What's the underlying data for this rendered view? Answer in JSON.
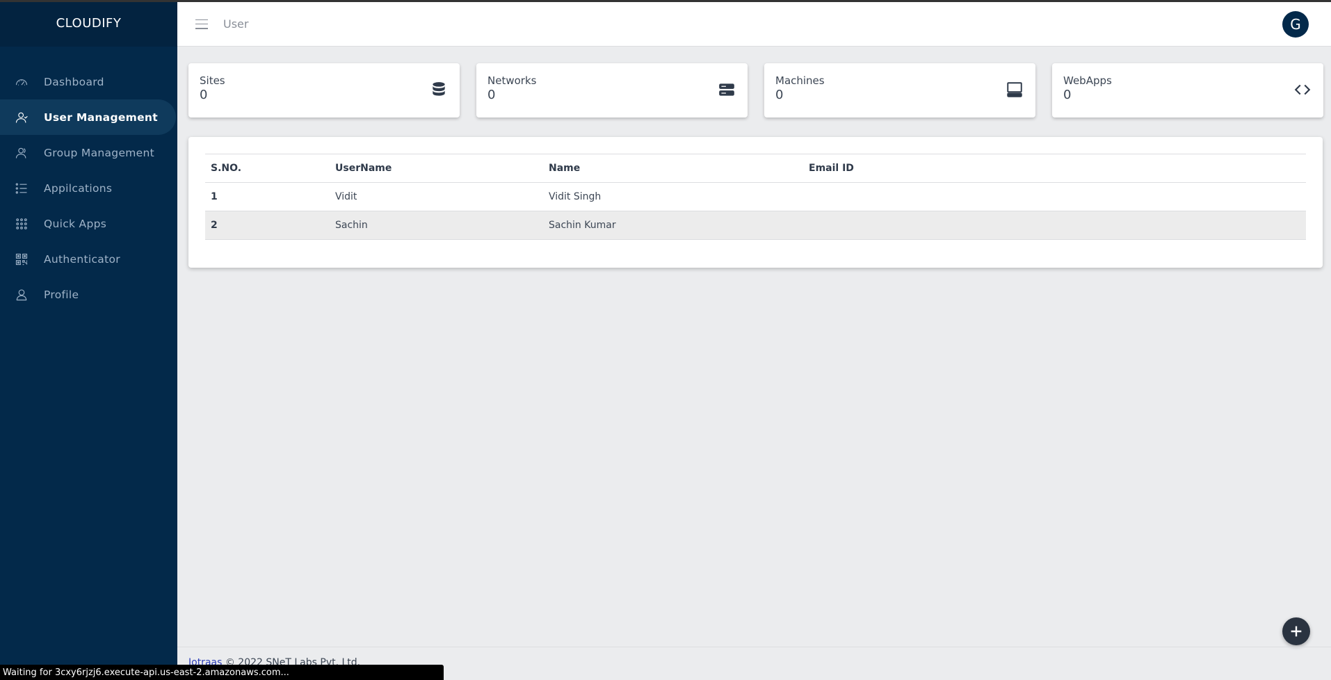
{
  "brand": "CLOUDIFY",
  "sidebar": {
    "items": [
      {
        "label": "Dashboard",
        "icon": "gauge-icon"
      },
      {
        "label": "User Management",
        "icon": "users-icon",
        "active": true
      },
      {
        "label": "Group Management",
        "icon": "group-icon"
      },
      {
        "label": "Appilcations",
        "icon": "list-icon"
      },
      {
        "label": "Quick Apps",
        "icon": "grid-icon"
      },
      {
        "label": "Authenticator",
        "icon": "qr-icon"
      },
      {
        "label": "Profile",
        "icon": "person-icon"
      }
    ]
  },
  "header": {
    "title": "User",
    "avatar_letter": "G"
  },
  "cards": [
    {
      "label": "Sites",
      "value": "0",
      "icon": "database-icon"
    },
    {
      "label": "Networks",
      "value": "0",
      "icon": "server-icon"
    },
    {
      "label": "Machines",
      "value": "0",
      "icon": "computer-icon"
    },
    {
      "label": "WebApps",
      "value": "0",
      "icon": "code-icon"
    }
  ],
  "table": {
    "headers": [
      "S.NO.",
      "UserName",
      "Name",
      "Email ID"
    ],
    "rows": [
      {
        "sno": "1",
        "username": "Vidit",
        "name": "Vidit Singh",
        "email": ""
      },
      {
        "sno": "2",
        "username": "Sachin",
        "name": "Sachin Kumar",
        "email": ""
      }
    ]
  },
  "footer": {
    "link": "Iotraas",
    "text": " © 2022 SNeT Labs Pvt. Ltd."
  },
  "status_bar": "Waiting for 3cxy6rjzj6.execute-api.us-east-2.amazonaws.com...",
  "colors": {
    "sidebar_bg": "#03294a",
    "brand_bg": "#032340",
    "content_bg": "#ebecee",
    "avatar_bg": "#03294a"
  }
}
